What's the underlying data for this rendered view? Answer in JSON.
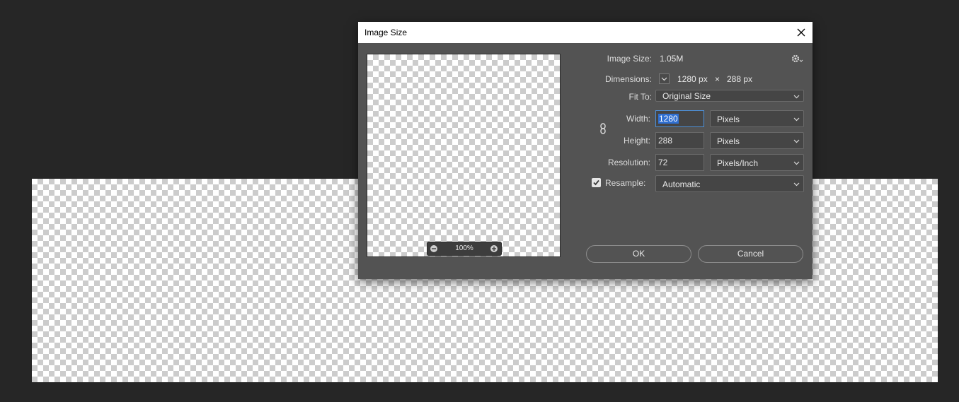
{
  "dialog": {
    "title": "Image Size",
    "image_size_label": "Image Size:",
    "image_size_value": "1.05M",
    "dimensions_label": "Dimensions:",
    "dimensions_width": "1280 px",
    "dimensions_separator": "×",
    "dimensions_height": "288 px",
    "fit_to_label": "Fit To:",
    "fit_to_value": "Original Size",
    "width_label": "Width:",
    "width_value": "1280",
    "width_unit": "Pixels",
    "height_label": "Height:",
    "height_value": "288",
    "height_unit": "Pixels",
    "resolution_label": "Resolution:",
    "resolution_value": "72",
    "resolution_unit": "Pixels/Inch",
    "resample_label": "Resample:",
    "resample_checked": true,
    "resample_value": "Automatic",
    "ok_label": "OK",
    "cancel_label": "Cancel",
    "preview_zoom": "100%"
  },
  "icons": {
    "close": "close-icon",
    "settings": "gear-icon",
    "link": "chain-link-icon",
    "zoom_out": "zoom-out-icon",
    "zoom_in": "zoom-in-icon",
    "dropdown": "chevron-down-icon",
    "checkbox": "checkmark-icon"
  },
  "colors": {
    "dialog_bg": "#535353",
    "app_bg": "#262626",
    "selection": "#2f6fd1"
  }
}
